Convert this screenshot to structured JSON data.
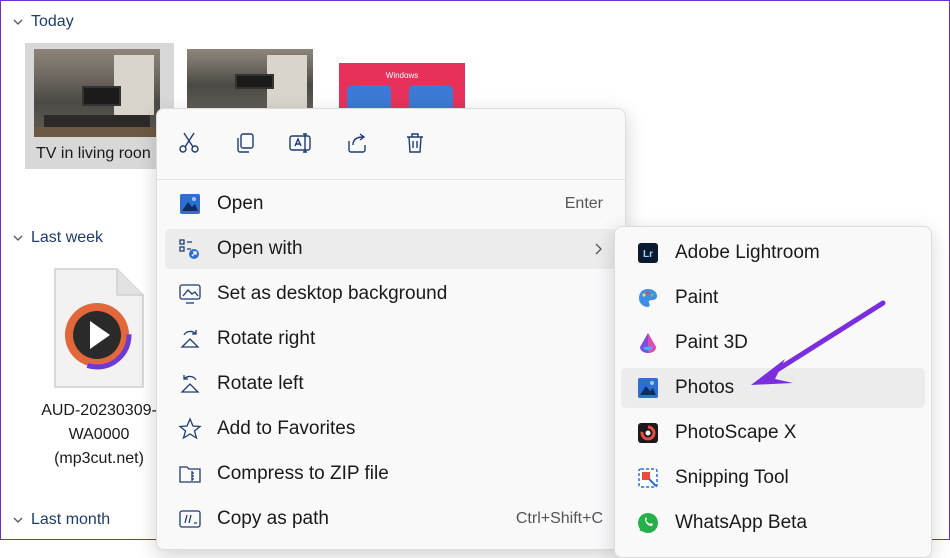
{
  "groups": {
    "today": "Today",
    "last_week": "Last week",
    "last_month": "Last month"
  },
  "files": {
    "photo1_label": "TV in living roon",
    "thumb3_text": "Windows",
    "audio_label_line1": "AUD-20230309-",
    "audio_label_line2": "WA0000",
    "audio_label_line3": "(mp3cut.net)"
  },
  "quick_actions": [
    "cut-icon",
    "copy-icon",
    "rename-icon",
    "share-icon",
    "delete-icon"
  ],
  "menu": {
    "open": {
      "label": "Open",
      "shortcut": "Enter"
    },
    "open_with": {
      "label": "Open with"
    },
    "set_background": {
      "label": "Set as desktop background"
    },
    "rotate_right": {
      "label": "Rotate right"
    },
    "rotate_left": {
      "label": "Rotate left"
    },
    "add_favorites": {
      "label": "Add to Favorites"
    },
    "compress_zip": {
      "label": "Compress to ZIP file"
    },
    "copy_path": {
      "label": "Copy as path",
      "shortcut": "Ctrl+Shift+C"
    }
  },
  "submenu": {
    "lightroom": {
      "label": "Adobe Lightroom",
      "icon_text": "Lr"
    },
    "paint": {
      "label": "Paint"
    },
    "paint3d": {
      "label": "Paint 3D"
    },
    "photos": {
      "label": "Photos"
    },
    "photoscape": {
      "label": "PhotoScape X"
    },
    "snipping": {
      "label": "Snipping Tool"
    },
    "whatsapp": {
      "label": "WhatsApp Beta"
    }
  },
  "colors": {
    "accent": "#7a2ee0",
    "header_text": "#1f3c6e",
    "menu_bg": "#f9f9fa",
    "hover_bg": "#ececec",
    "border": "#6b2fd6"
  }
}
